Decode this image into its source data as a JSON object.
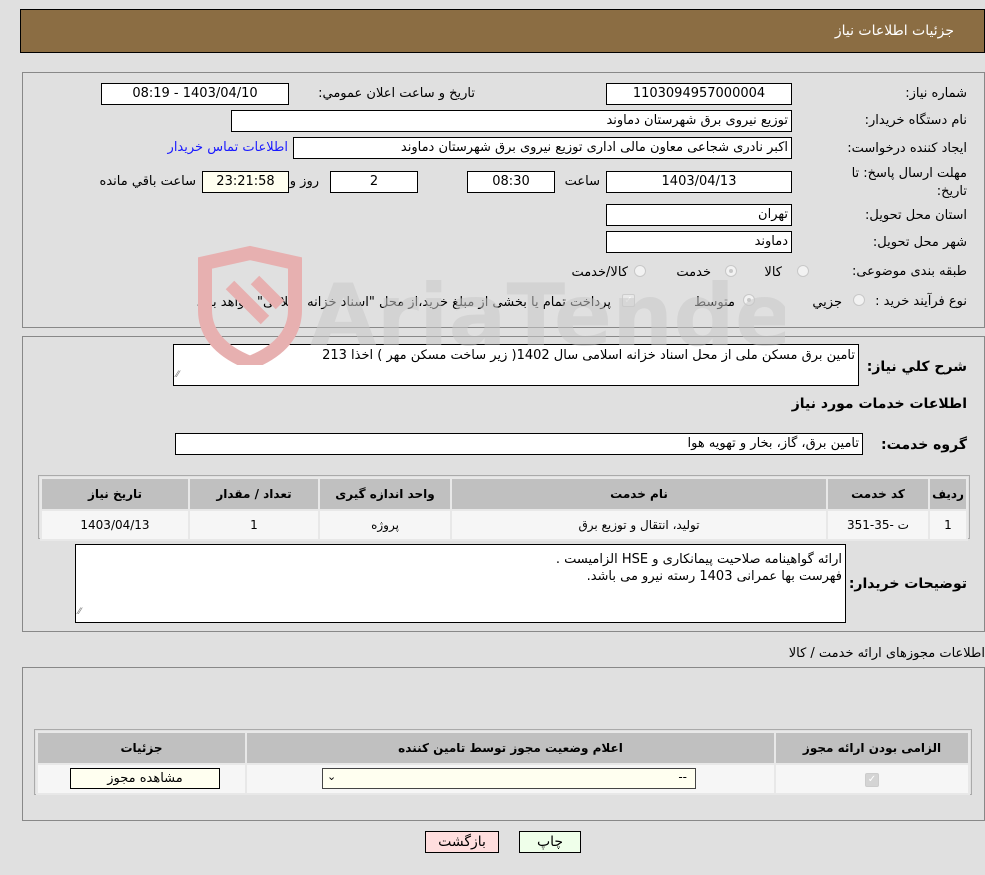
{
  "header": {
    "title": "جزئیات اطلاعات نیاز"
  },
  "details": {
    "need_number_label": "شماره نیاز:",
    "need_number": "1103094957000004",
    "announce_label": "تاریخ و ساعت اعلان عمومي:",
    "announce_value": "1403/04/10 - 08:19",
    "buyer_org_label": "نام دستگاه خریدار:",
    "buyer_org": "توزیع نیروی برق شهرستان دماوند",
    "creator_label": "ایجاد کننده درخواست:",
    "creator": "اکبر نادری شجاعی معاون مالی اداری توزیع نیروی برق شهرستان دماوند",
    "contact_link": "اطلاعات تماس خریدار",
    "deadline_label": "مهلت ارسال پاسخ: تا تاریخ:",
    "deadline_date": "1403/04/13",
    "time_label": "ساعت",
    "deadline_time": "08:30",
    "days_value": "2",
    "days_label": "روز و",
    "remaining_time": "23:21:58",
    "remaining_label": "ساعت باقي مانده",
    "province_label": "استان محل تحویل:",
    "province": "تهران",
    "city_label": "شهر محل تحویل:",
    "city": "دماوند",
    "category_label": "طبقه بندی موضوعی:",
    "category_options": [
      "کالا",
      "خدمت",
      "کالا/خدمت"
    ],
    "category_selected": "خدمت",
    "process_label": "نوع فرآیند خرید :",
    "process_options": [
      "جزيي",
      "متوسط"
    ],
    "process_selected": "متوسط",
    "treasury_note": "پرداخت تمام یا بخشی از مبلغ خرید،از محل \"اسناد خزانه اسلامی\" خواهد بود."
  },
  "summary": {
    "general_desc_label": "شرح كلي نياز:",
    "general_desc": "تامین برق مسکن ملی از محل اسناد خزانه اسلامی سال 1402( زیر ساخت مسکن مهر ) اخذا 213",
    "services_title": "اطلاعات خدمات مورد نياز",
    "service_group_label": "گروه خدمت:",
    "service_group": "تامین برق، گاز، بخار و تهویه هوا",
    "table": {
      "headers": [
        "رديف",
        "کد خدمت",
        "نام خدمت",
        "واحد اندازه گیری",
        "تعداد / مقدار",
        "تاریخ نیاز"
      ],
      "rows": [
        [
          "1",
          "ت -35-351",
          "تولید، انتقال و توزیع برق",
          "پروژه",
          "1",
          "1403/04/13"
        ]
      ]
    },
    "buyer_notes_label": "توضیحات خریدار:",
    "buyer_notes_lines": [
      "ارائه گواهینامه صلاحیت پیمانکاری و HSE الزامیست .",
      "فهرست بها عمرانی 1403 رسته نیرو می باشد."
    ]
  },
  "permits": {
    "title": "اطلاعات مجوزهای ارائه خدمت / کالا",
    "headers": [
      "الزامی بودن ارائه مجوز",
      "اعلام وضعیت مجوز توسط تامین کننده",
      "جزئیات"
    ],
    "row": {
      "required_checked": true,
      "status_value": "--",
      "details_button": "مشاهده مجوز"
    }
  },
  "footer": {
    "print_button": "چاپ",
    "back_button": "بازگشت"
  },
  "watermark": {
    "text": "AriaTender.neT"
  }
}
